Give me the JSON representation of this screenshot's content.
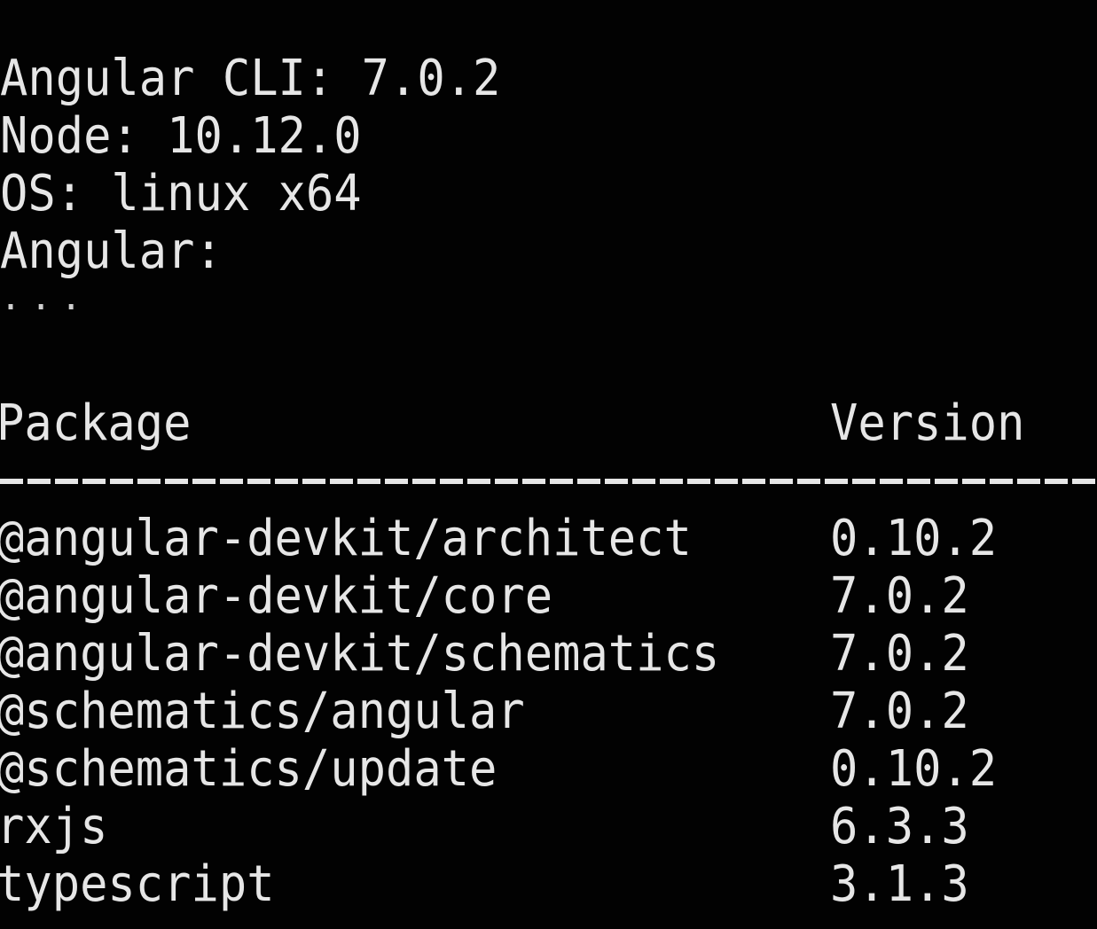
{
  "info": {
    "cli_line": "Angular CLI: 7.0.2",
    "node_line": "Node: 10.12.0",
    "os_line": "OS: linux x64",
    "angular_line": "Angular:",
    "ellipsis": "..."
  },
  "table": {
    "headers": {
      "package": "Package",
      "version": "Version"
    },
    "separator": "------------------------------------------------------------",
    "rows": [
      {
        "package": "@angular-devkit/architect",
        "version": "0.10.2"
      },
      {
        "package": "@angular-devkit/core",
        "version": "7.0.2"
      },
      {
        "package": "@angular-devkit/schematics",
        "version": "7.0.2"
      },
      {
        "package": "@schematics/angular",
        "version": "7.0.2"
      },
      {
        "package": "@schematics/update",
        "version": "0.10.2"
      },
      {
        "package": "rxjs",
        "version": "6.3.3"
      },
      {
        "package": "typescript",
        "version": "3.1.3"
      }
    ]
  },
  "colors": {
    "background": "#020202",
    "text": "#e6e6e6"
  }
}
